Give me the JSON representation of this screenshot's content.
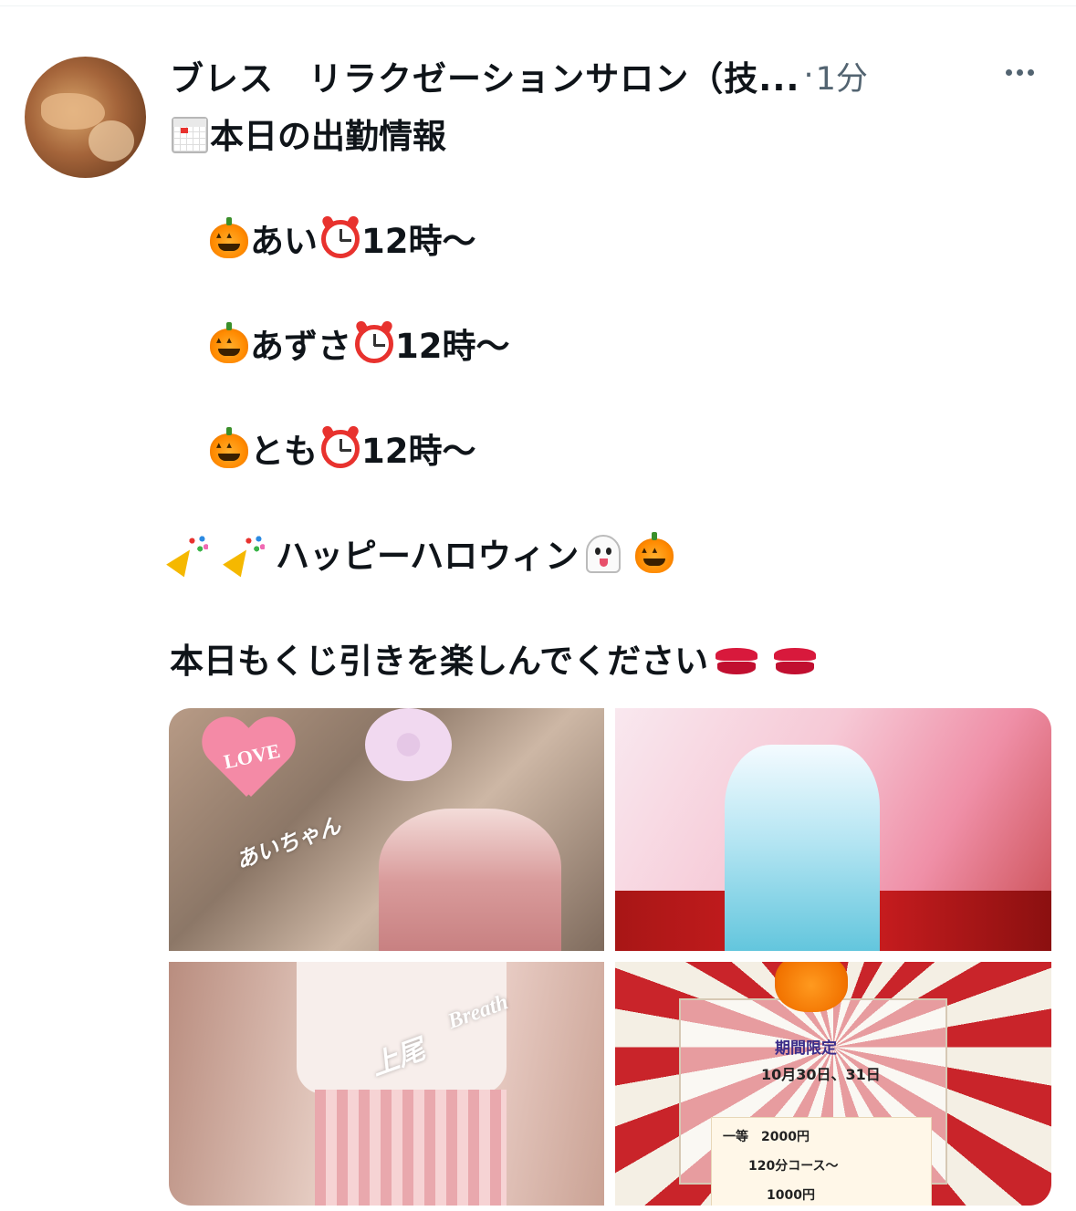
{
  "post": {
    "author_name": "ブレス　リラクゼーションサロン（技...",
    "separator": "·",
    "time_ago": "1分",
    "more_label": "More",
    "lines": {
      "heading": "本日の出勤情報",
      "staff1_name": "あい",
      "staff1_time": "12時〜",
      "staff2_name": "あずさ",
      "staff2_time": "12時〜",
      "staff3_name": "とも",
      "staff3_time": "12時〜",
      "halloween": "ハッピーハロウィン",
      "closing": "本日もくじ引きを楽しんでください"
    },
    "icons": {
      "calendar": "calendar-icon",
      "pumpkin": "jack-o-lantern-icon",
      "clock": "alarm-clock-icon",
      "popper": "party-popper-icon",
      "ghost": "ghost-icon",
      "kiss": "kiss-mark-icon"
    },
    "media": {
      "image1": {
        "label_love": "LOVE",
        "label_name": "あいちゃん"
      },
      "image3": {
        "label_name": "上尾",
        "label_brand": "Breath"
      },
      "image4": {
        "title": "期間限定",
        "dates": "10月30日、31日",
        "prize_line1": "一等　2000円",
        "prize_line2": "120分コース〜",
        "prize_line3": "1000円"
      }
    }
  },
  "colors": {
    "text": "#0f1419",
    "muted": "#536471",
    "background": "#ffffff"
  }
}
